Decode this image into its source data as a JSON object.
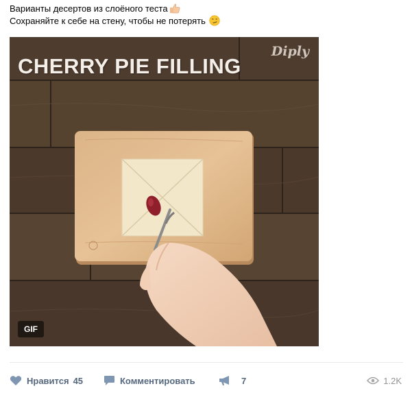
{
  "post": {
    "text_line1": "Варианты десертов из слоёного теста",
    "text_line2": "Сохраняйте к себе на стену, чтобы не потерять"
  },
  "media": {
    "title": "CHERRY PIE FILLING",
    "watermark": "Diply",
    "badge": "GIF"
  },
  "actions": {
    "like_label": "Нравится",
    "like_count": "45",
    "comment_label": "Комментировать",
    "share_count": "7",
    "views_count": "1.2K"
  },
  "colors": {
    "action_text": "#55677d",
    "views_text": "#939393",
    "divider": "#e7e8ec"
  },
  "icons": [
    "thumbs-up-emoji",
    "smirk-emoji",
    "heart-icon",
    "comment-icon",
    "share-megaphone-icon",
    "eye-icon"
  ]
}
